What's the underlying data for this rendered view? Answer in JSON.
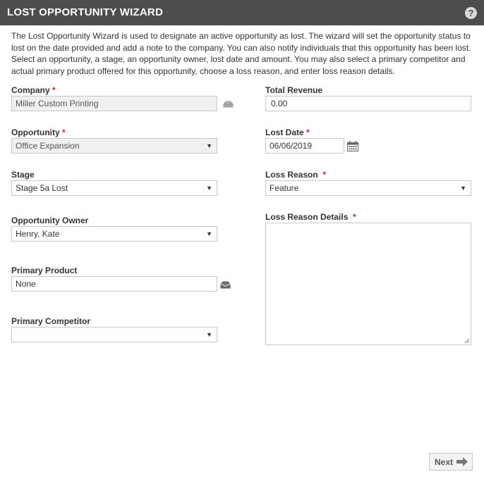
{
  "header": {
    "title": "LOST OPPORTUNITY WIZARD",
    "help_glyph": "?"
  },
  "description": "The Lost Opportunity Wizard is used to designate an active opportunity as lost. The wizard will set the opportunity status to lost on the date provided and add a note to the company. You can also notify individuals that this opportunity has been lost.  Select an opportunity, a stage, an opportunity owner, lost date and amount. You may also select a primary competitor and actual primary product offered for this opportunity, choose a loss reason, and enter loss reason details.",
  "required_mark": "*",
  "left": {
    "company": {
      "label": "Company",
      "value": "Miller Custom Printing"
    },
    "opportunity": {
      "label": "Opportunity",
      "value": "Office Expansion"
    },
    "stage": {
      "label": "Stage",
      "value": "Stage 5a Lost"
    },
    "owner": {
      "label": "Opportunity Owner",
      "value": "Henry, Kate"
    },
    "product": {
      "label": "Primary Product",
      "value": "None"
    },
    "competitor": {
      "label": "Primary Competitor",
      "value": ""
    }
  },
  "right": {
    "revenue": {
      "label": "Total Revenue",
      "value": "0.00"
    },
    "lost_date": {
      "label": "Lost Date",
      "value": "06/06/2019"
    },
    "loss_reason": {
      "label": "Loss Reason",
      "value": "Feature"
    },
    "loss_details": {
      "label": "Loss Reason Details",
      "value": ""
    }
  },
  "footer": {
    "next_label": "Next"
  },
  "icons": {
    "help": "help-icon",
    "lookup": "lookup-tray-icon",
    "calendar": "calendar-icon",
    "dropdown": "chevron-down-icon",
    "next": "arrow-right-icon"
  },
  "colors": {
    "header_bg": "#4d4d4d",
    "required": "#d42020",
    "border": "#c8c8c8",
    "disabled_bg": "#f0f0f0"
  }
}
